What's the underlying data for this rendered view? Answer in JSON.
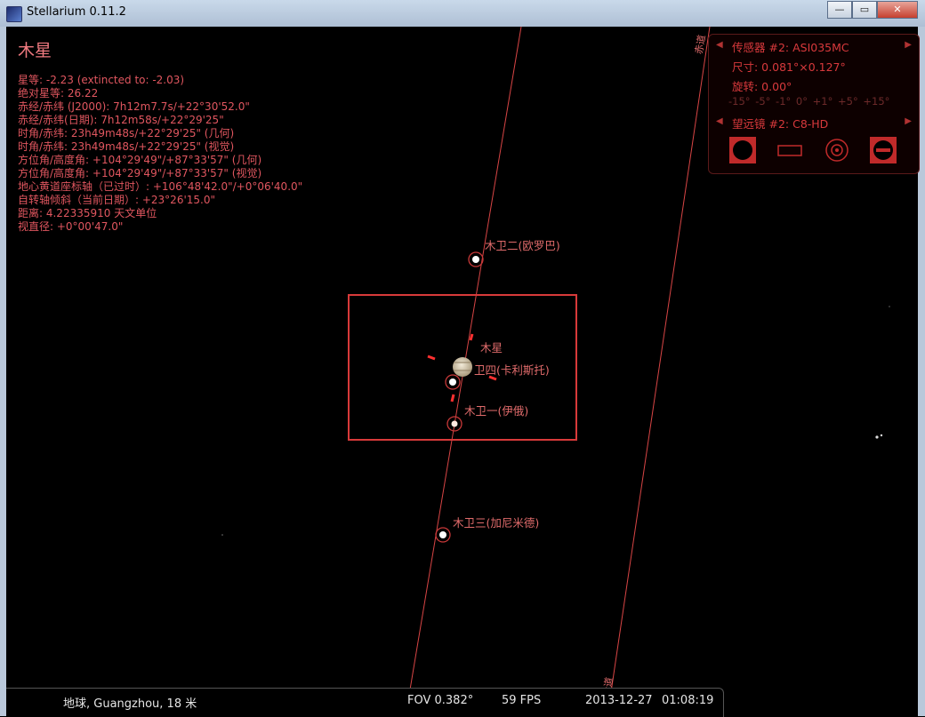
{
  "window": {
    "title": "Stellarium 0.11.2",
    "controls": {
      "minimize": "—",
      "maximize": "▭",
      "close": "✕"
    }
  },
  "object_info": {
    "name": "木星",
    "lines": [
      "星等: -2.23 (extincted to: -2.03)",
      "绝对星等: 26.22",
      "赤经/赤纬 (J2000): 7h12m7.7s/+22°30'52.0\"",
      "赤经/赤纬(日期): 7h12m58s/+22°29'25\"",
      "时角/赤纬: 23h49m48s/+22°29'25\" (几何)",
      "时角/赤纬: 23h49m48s/+22°29'25\" (视觉)",
      "方位角/高度角: +104°29'49\"/+87°33'57\" (几何)",
      "方位角/高度角: +104°29'49\"/+87°33'57\" (视觉)",
      "地心黄道座标轴（已过时）: +106°48'42.0\"/+0°06'40.0\"",
      "自转轴倾斜（当前日期）: +23°26'15.0\"",
      "距离: 4.22335910 天文单位",
      "视直径: +0°00'47.0\""
    ]
  },
  "ocular_panel": {
    "sensor": "传感器 #2: ASI035MC",
    "size": "尺寸: 0.081°×0.127°",
    "rotation": "旋转: 0.00°",
    "rotation_options": "-15° -5° -1° 0° +1° +5° +15°",
    "telescope": "望远镜 #2: C8-HD",
    "buttons": [
      "ccd-toggle-icon",
      "frame-icon",
      "ocular-icon",
      "settings-icon"
    ]
  },
  "sky_labels": {
    "jupiter": "木星",
    "europa": "木卫二(欧罗巴)",
    "callisto": "卫四(卡利斯托)",
    "io": "木卫一(伊俄)",
    "ganymede": "木卫三(加尼米德)",
    "equator_top": "赤道",
    "equator_bottom": "赤道"
  },
  "status_bar": {
    "location": "地球, Guangzhou, 18 米",
    "fov": "FOV 0.382°",
    "fps": "59 FPS",
    "date": "2013-12-27",
    "time": "01:08:19"
  },
  "colors": {
    "accent": "#d8393c",
    "info_text": "#e0565f",
    "sky": "#000000"
  }
}
